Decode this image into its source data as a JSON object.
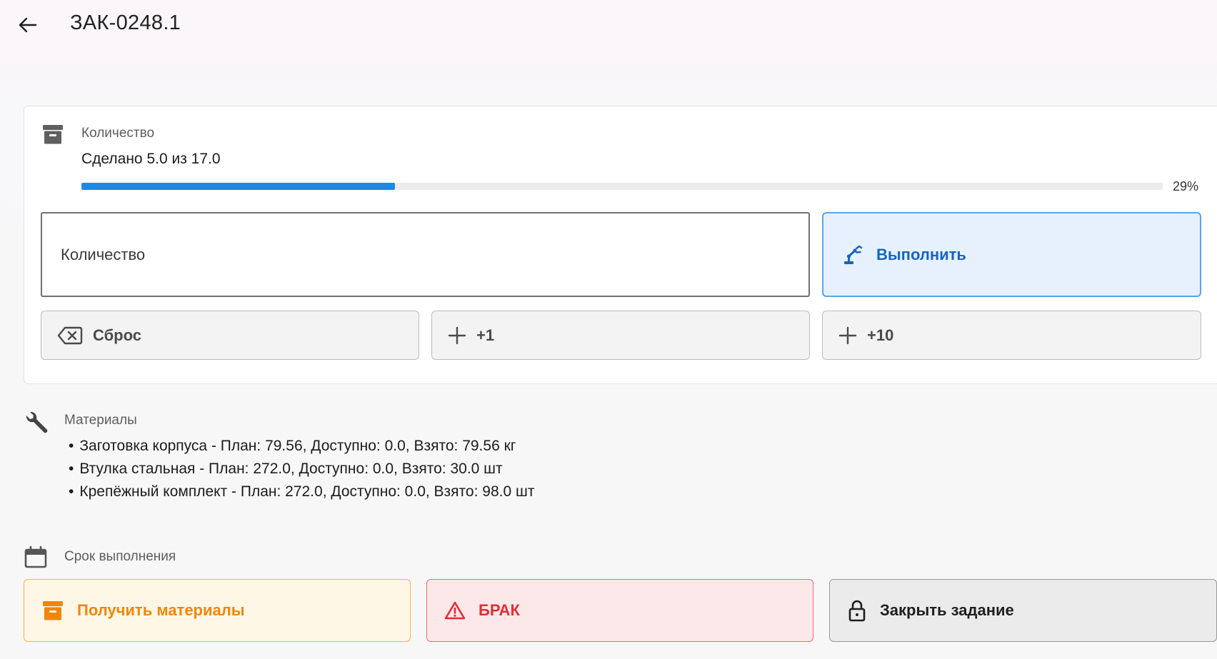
{
  "header": {
    "title": "ЗАК-0248.1"
  },
  "quantity": {
    "label": "Количество",
    "done_text": "Сделано 5.0 из 17.0",
    "progress": 0.29,
    "progress_text": "29%",
    "input_placeholder": "Количество",
    "execute_label": "Выполнить",
    "reset_label": "Сброс",
    "plus1_label": "+1",
    "plus10_label": "+10"
  },
  "materials": {
    "label": "Материалы",
    "items": [
      "Заготовка корпуса - План: 79.56, Доступно: 0.0, Взято: 79.56 кг",
      "Втулка стальная - План: 272.0, Доступно: 0.0, Взято: 30.0 шт",
      "Крепёжный комплект - План: 272.0, Доступно: 0.0, Взято: 98.0 шт"
    ]
  },
  "deadline": {
    "label": "Срок выполнения"
  },
  "actions": {
    "get_materials_label": "Получить материалы",
    "defect_label": "БРАК",
    "close_task_label": "Закрыть задание"
  },
  "icons": {
    "back": "arrow-left-icon",
    "quantity": "archive-box-icon",
    "execute": "robot-arm-icon",
    "reset": "backspace-icon",
    "plus": "plus-icon",
    "materials": "wrench-icon",
    "deadline": "calendar-icon",
    "get_materials": "archive-box-icon",
    "defect": "warning-icon",
    "close_task": "lock-icon"
  },
  "colors": {
    "accent_blue": "#1e88e5",
    "execute_text": "#1565c0",
    "materials_orange": "#f0860a",
    "defect_red": "#e22d35"
  }
}
